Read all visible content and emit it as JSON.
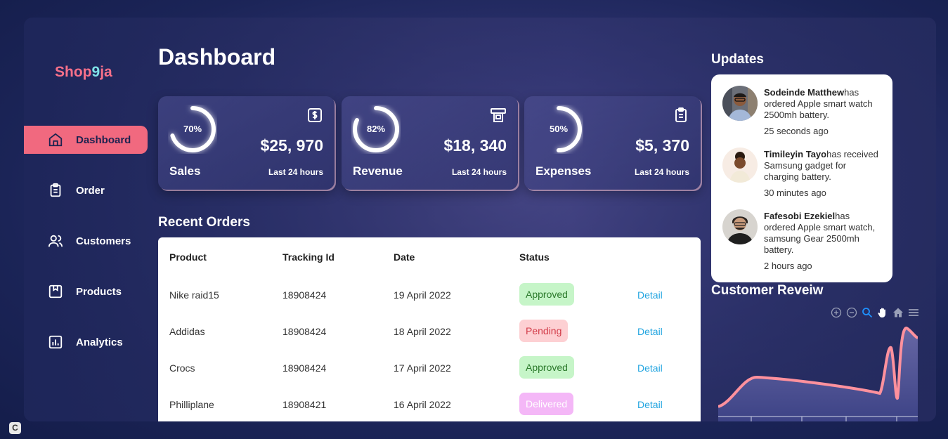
{
  "brand": {
    "prefix": "Shop",
    "accent": "9",
    "suffix": "ja"
  },
  "nav": [
    {
      "label": "Dashboard",
      "icon": "home-icon",
      "active": true
    },
    {
      "label": "Order",
      "icon": "clipboard-icon"
    },
    {
      "label": "Customers",
      "icon": "users-icon"
    },
    {
      "label": "Products",
      "icon": "bookmark-box-icon"
    },
    {
      "label": "Analytics",
      "icon": "bar-chart-icon"
    }
  ],
  "page_title": "Dashboard",
  "cards": [
    {
      "label": "Sales",
      "percent": 70,
      "percent_label": "70%",
      "value": "$25, 970",
      "sub": "Last 24 hours",
      "icon": "dollar-doc-icon"
    },
    {
      "label": "Revenue",
      "percent": 82,
      "percent_label": "82%",
      "value": "$18, 340",
      "sub": "Last 24 hours",
      "icon": "cash-register-icon"
    },
    {
      "label": "Expenses",
      "percent": 50,
      "percent_label": "50%",
      "value": "$5, 370",
      "sub": "Last 24 hours",
      "icon": "clipboard-icon"
    }
  ],
  "recent_orders": {
    "title": "Recent Orders",
    "headers": [
      "Product",
      "Tracking Id",
      "Date",
      "Status"
    ],
    "rows": [
      {
        "product": "Nike raid15",
        "tracking": "18908424",
        "date": "19 April 2022",
        "status": "Approved",
        "action": "Detail"
      },
      {
        "product": "Addidas",
        "tracking": "18908424",
        "date": "18 April 2022",
        "status": "Pending",
        "action": "Detail"
      },
      {
        "product": "Crocs",
        "tracking": "18908424",
        "date": "17 April 2022",
        "status": "Approved",
        "action": "Detail"
      },
      {
        "product": "Philliplane",
        "tracking": "18908421",
        "date": "16 April 2022",
        "status": "Delivered",
        "action": "Detail"
      }
    ]
  },
  "updates": {
    "title": "Updates",
    "items": [
      {
        "name": "Sodeinde Matthew",
        "text": "has ordered Apple smart watch 2500mh battery.",
        "time": "25 seconds ago"
      },
      {
        "name": "Timileyin Tayo",
        "text": "has received Samsung gadget for charging battery.",
        "time": "30 minutes ago"
      },
      {
        "name": "Fafesobi Ezekiel",
        "text": "has ordered Apple smart watch, samsung Gear 2500mh battery.",
        "time": "2 hours ago"
      }
    ]
  },
  "review": {
    "title": "Customer Reveiw"
  },
  "colors": {
    "accent": "#f1697f",
    "chart_line": "#ff919d",
    "approved": "#c6f5c8",
    "pending": "#fdd0d3",
    "delivered": "#f4b7f7",
    "link": "#22a5e0"
  }
}
